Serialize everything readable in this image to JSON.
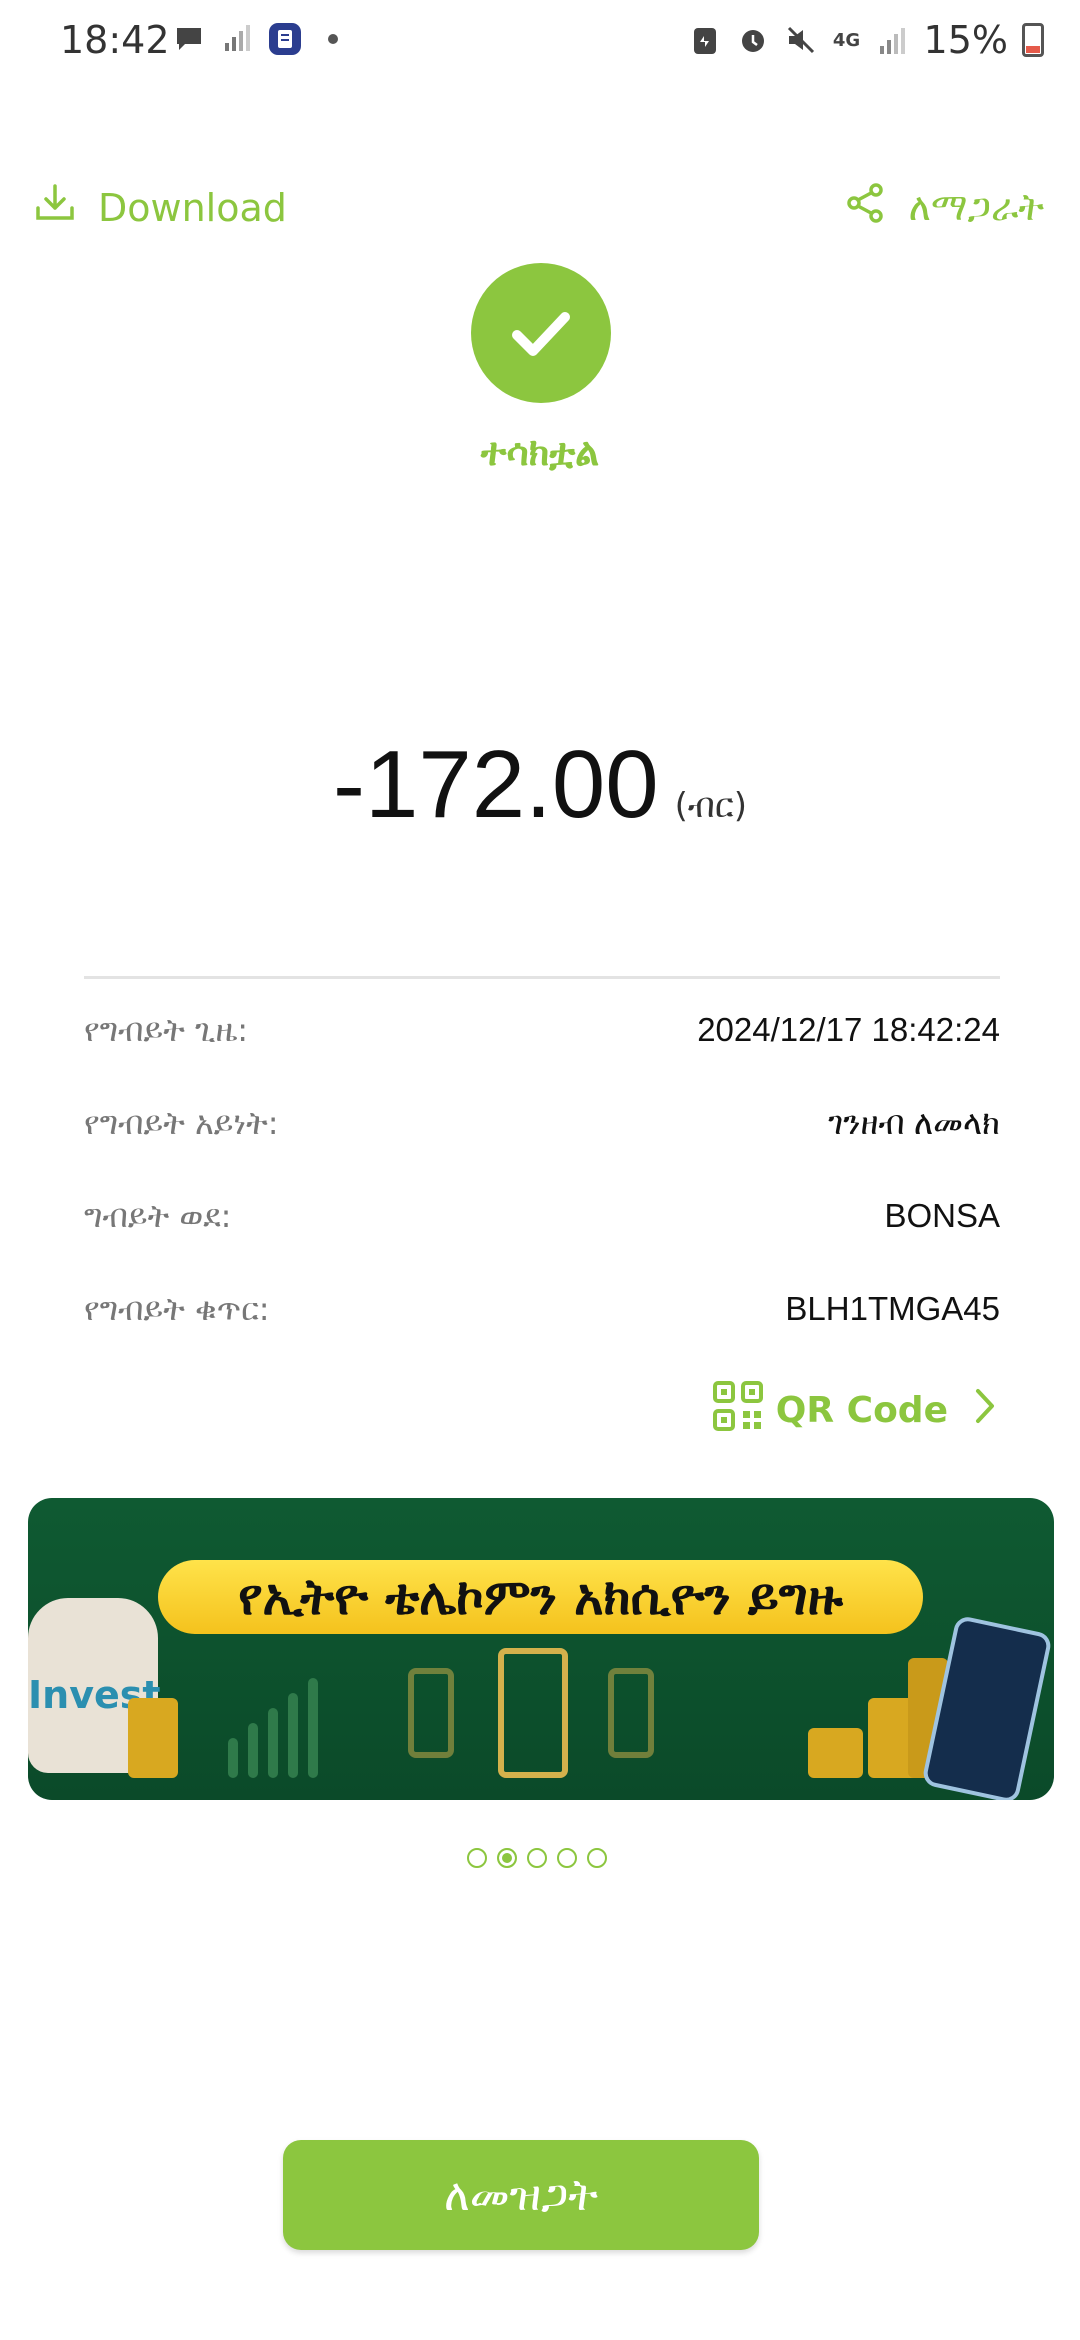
{
  "status_bar": {
    "time": "18:42",
    "battery": "15%",
    "network": "4G",
    "icons_left": [
      "chat-bubble-icon",
      "no-signal-icon",
      "app-notification-icon",
      "dot-icon"
    ],
    "icons_right": [
      "clipboard-icon",
      "alarm-icon",
      "mute-icon",
      "network-4g-icon",
      "signal-icon",
      "battery-icon"
    ]
  },
  "actions": {
    "download_label": "Download",
    "share_label": "ለማጋራት"
  },
  "success": {
    "label": "ተሳክቷል"
  },
  "transaction": {
    "amount": "-172.00",
    "currency": "(ብር)",
    "rows": [
      {
        "label": "የግብይት ጊዜ:",
        "value": "2024/12/17 18:42:24"
      },
      {
        "label": "የግብይት አይነት:",
        "value": "ገንዘብ ለመላክ"
      },
      {
        "label": "ግብይት ወደ:",
        "value": "BONSA"
      },
      {
        "label": "የግብይት ቁጥር:",
        "value": "BLH1TMGA45"
      }
    ],
    "qr_label": "QR Code"
  },
  "banner": {
    "title": "የኢትዮ ቴሌኮምን አክሲዮን ይግዙ",
    "bag_text": "Invest",
    "page_count": 5,
    "active_page": 2
  },
  "confirm_label": "ለመዝጋት",
  "colors": {
    "accent": "#8cc63f",
    "banner_bg": "#0f5a32",
    "banner_title_bg": "#ffe34a"
  }
}
